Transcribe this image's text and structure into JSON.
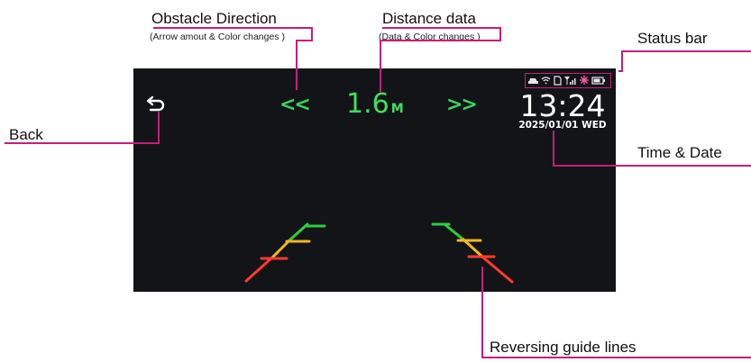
{
  "annotations": {
    "obstacle_direction": {
      "title": "Obstacle Direction",
      "subtitle": "(Arrow amout & Color changes )"
    },
    "distance_data": {
      "title": "Distance data",
      "subtitle": "(Data & Color changes )"
    },
    "status_bar": {
      "title": "Status bar"
    },
    "back": {
      "title": "Back"
    },
    "time_date": {
      "title": "Time & Date"
    },
    "guide_lines": {
      "title": "Reversing guide lines"
    }
  },
  "screen": {
    "direction_left": "<<",
    "direction_right": ">>",
    "distance_value": "1.6",
    "distance_unit": "M",
    "time": "13:24",
    "date": "2025/01/01 WED",
    "status_icons": [
      "car-icon",
      "wifi-icon",
      "sd-card-icon",
      "signal-icon",
      "sun-icon",
      "battery-icon"
    ]
  },
  "colors": {
    "leader": "#c51d7d",
    "guide_green": "#2ecc40",
    "guide_yellow": "#f3b821",
    "guide_red": "#ff3b30",
    "indicator_green": "#38d65a",
    "screen_bg": "#131417"
  }
}
